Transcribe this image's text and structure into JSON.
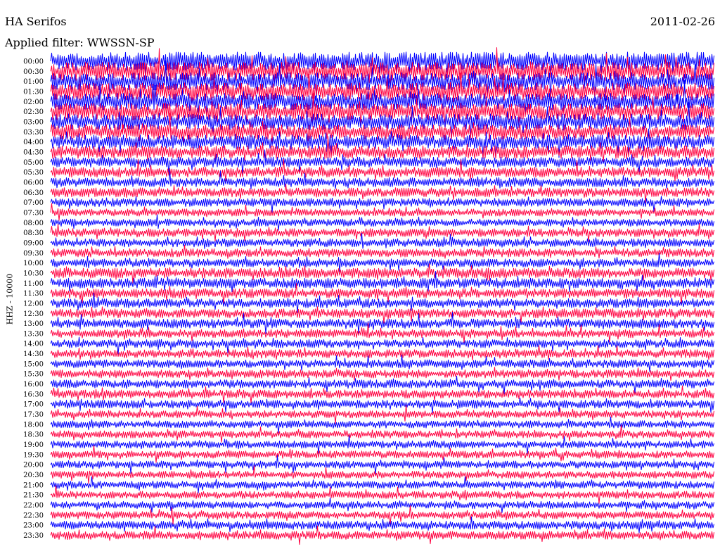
{
  "header": {
    "station": "HA Serifos",
    "date": "2011-02-26",
    "filter": "Applied filter: WWSSN-SP"
  },
  "chart_data": {
    "type": "line",
    "title": "HA Serifos",
    "date": "2011-02-26",
    "filter": "WWSSN-SP",
    "ylabel": "HHZ - 10000",
    "row_labels": [
      "00:00",
      "00:30",
      "01:00",
      "01:30",
      "02:00",
      "02:30",
      "03:00",
      "03:30",
      "04:00",
      "04:30",
      "05:00",
      "05:30",
      "06:00",
      "06:30",
      "07:00",
      "07:30",
      "08:00",
      "08:30",
      "09:00",
      "09:30",
      "10:00",
      "10:30",
      "11:00",
      "11:30",
      "12:00",
      "12:30",
      "13:00",
      "13:30",
      "14:00",
      "14:30",
      "15:00",
      "15:30",
      "16:00",
      "16:30",
      "17:00",
      "17:30",
      "18:00",
      "18:30",
      "19:00",
      "19:30",
      "20:00",
      "20:30",
      "21:00",
      "21:30",
      "22:00",
      "22:30",
      "23:00",
      "23:30"
    ],
    "series_colors": [
      "#0000ff",
      "#ff0040"
    ],
    "trace_style": "seismic waveform, alternating colors per 30-minute row",
    "relative_amplitude": [
      1.0,
      1.0,
      0.95,
      0.95,
      0.9,
      0.9,
      0.85,
      0.8,
      0.75,
      0.7,
      0.55,
      0.55,
      0.5,
      0.5,
      0.45,
      0.4,
      0.4,
      0.45,
      0.45,
      0.45,
      0.45,
      0.55,
      0.55,
      0.5,
      0.5,
      0.5,
      0.5,
      0.45,
      0.45,
      0.45,
      0.45,
      0.45,
      0.45,
      0.45,
      0.45,
      0.4,
      0.4,
      0.4,
      0.4,
      0.4,
      0.4,
      0.4,
      0.4,
      0.4,
      0.4,
      0.4,
      0.45,
      0.45
    ]
  }
}
